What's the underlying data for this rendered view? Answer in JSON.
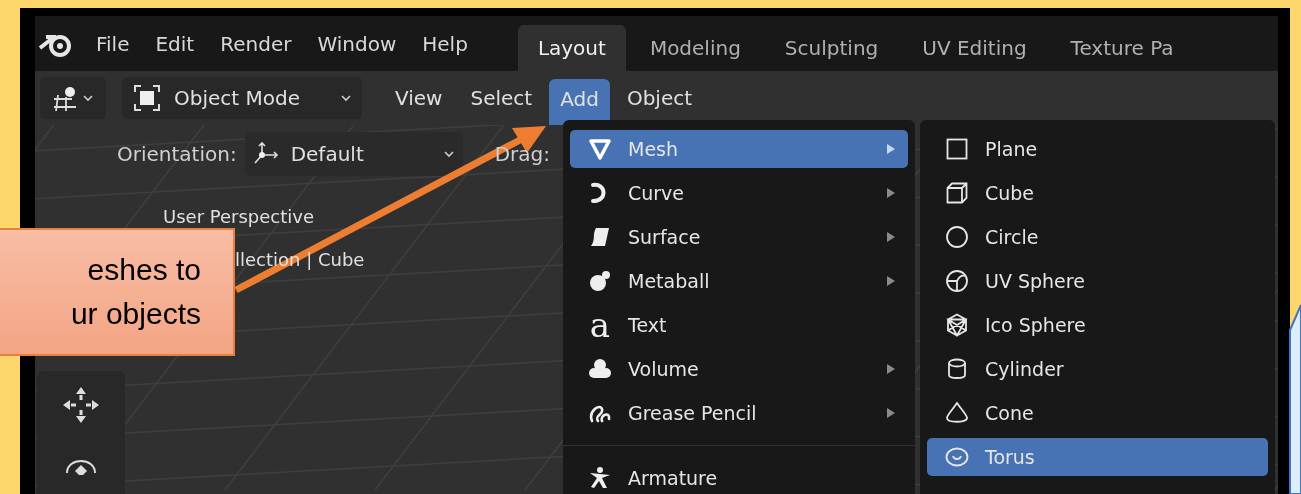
{
  "menubar": {
    "items": [
      "File",
      "Edit",
      "Render",
      "Window",
      "Help"
    ]
  },
  "workspace_tabs": [
    {
      "label": "Layout",
      "selected": true
    },
    {
      "label": "Modeling",
      "selected": false
    },
    {
      "label": "Sculpting",
      "selected": false
    },
    {
      "label": "UV Editing",
      "selected": false
    },
    {
      "label": "Texture Pa",
      "selected": false
    }
  ],
  "header": {
    "mode": "Object Mode",
    "menus": [
      {
        "label": "View",
        "selected": false
      },
      {
        "label": "Select",
        "selected": false
      },
      {
        "label": "Add",
        "selected": true
      },
      {
        "label": "Object",
        "selected": false
      }
    ]
  },
  "tool_settings": {
    "orientation_label": "Orientation:",
    "orientation": "Default",
    "drag_label": "Drag:"
  },
  "viewport": {
    "overlay_lines": [
      "User Perspective",
      "llection | Cube"
    ]
  },
  "add_menu": {
    "groups": [
      [
        {
          "label": "Mesh",
          "kind": "submenu",
          "selected": true
        },
        {
          "label": "Curve",
          "kind": "submenu",
          "selected": false
        },
        {
          "label": "Surface",
          "kind": "submenu",
          "selected": false
        },
        {
          "label": "Metaball",
          "kind": "submenu",
          "selected": false
        },
        {
          "label": "Text",
          "kind": "action",
          "selected": false,
          "glyph": "a"
        },
        {
          "label": "Volume",
          "kind": "submenu",
          "selected": false
        },
        {
          "label": "Grease Pencil",
          "kind": "submenu",
          "selected": false
        }
      ],
      [
        {
          "label": "Armature",
          "kind": "action",
          "selected": false
        }
      ]
    ]
  },
  "mesh_submenu": {
    "items": [
      {
        "label": "Plane",
        "selected": false
      },
      {
        "label": "Cube",
        "selected": false
      },
      {
        "label": "Circle",
        "selected": false
      },
      {
        "label": "UV Sphere",
        "selected": false
      },
      {
        "label": "Ico Sphere",
        "selected": false
      },
      {
        "label": "Cylinder",
        "selected": false
      },
      {
        "label": "Cone",
        "selected": false
      },
      {
        "label": "Torus",
        "selected": true
      }
    ]
  },
  "callout": {
    "lines": [
      "eshes to",
      "ur objects"
    ]
  }
}
